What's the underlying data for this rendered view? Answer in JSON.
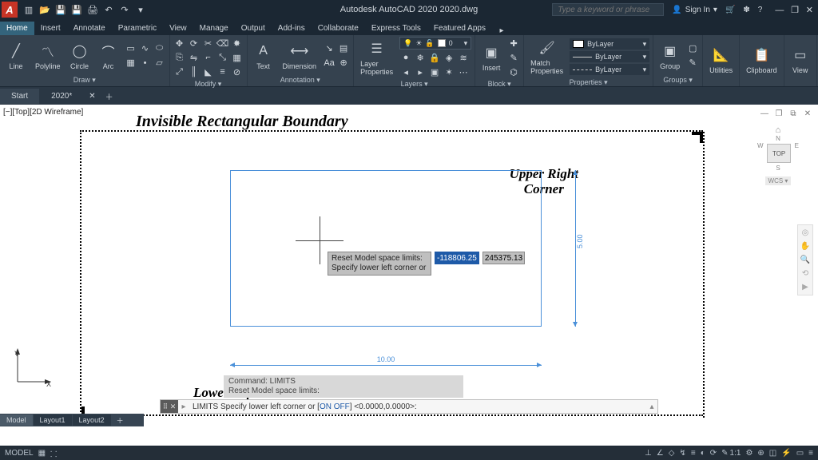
{
  "app_logo_letter": "A",
  "title": "Autodesk AutoCAD 2020   2020.dwg",
  "search_placeholder": "Type a keyword or phrase",
  "signin": "Sign In",
  "ribbon_tabs": [
    "Home",
    "Insert",
    "Annotate",
    "Parametric",
    "View",
    "Manage",
    "Output",
    "Add-ins",
    "Collaborate",
    "Express Tools",
    "Featured Apps"
  ],
  "panels": {
    "draw": {
      "label": "Draw ▾",
      "line": "Line",
      "polyline": "Polyline",
      "circle": "Circle",
      "arc": "Arc"
    },
    "modify": {
      "label": "Modify ▾"
    },
    "annotation": {
      "label": "Annotation ▾",
      "text": "Text",
      "dimension": "Dimension"
    },
    "layers": {
      "label": "Layers ▾",
      "layerprops": "Layer\nProperties",
      "current": "0"
    },
    "block": {
      "label": "Block ▾",
      "insert": "Insert"
    },
    "properties": {
      "label": "Properties ▾",
      "match": "Match\nProperties",
      "bylayer": "ByLayer"
    },
    "groups": {
      "label": "Groups ▾",
      "group": "Group"
    },
    "utilities": {
      "label": "Utilities"
    },
    "clipboard": {
      "label": "Clipboard"
    },
    "view": {
      "label": "View"
    }
  },
  "file_tabs": {
    "start": "Start",
    "doc": "2020*"
  },
  "view_label": "[−][Top][2D Wireframe]",
  "annotations": {
    "title": "Invisible Rectangular Boundary",
    "ur": "Upper Right\nCorner",
    "ll": "Lower Left\nCorner"
  },
  "dims": {
    "width": "10.00",
    "height": "5.00"
  },
  "dynamic_input": {
    "prompt_line1": "Reset Model space limits:",
    "prompt_line2": "Specify lower left corner or",
    "field1": "-118806.25",
    "field2": "245375.13"
  },
  "viewcube": {
    "n": "N",
    "s": "S",
    "e": "E",
    "w": "W",
    "face": "TOP",
    "wcs": "WCS ▾"
  },
  "ucs": {
    "x": "X",
    "y": "Y"
  },
  "command_history": {
    "l1": "Command: LIMITS",
    "l2": "Reset Model space limits:"
  },
  "cmdline": {
    "prefix": "LIMITS ",
    "body": "Specify lower left corner or [",
    "on": "ON",
    "off": "OFF",
    "tail": "] <0.0000,0.0000>:"
  },
  "model_tabs": [
    "Model",
    "Layout1",
    "Layout2"
  ],
  "statusbar": {
    "model": "MODEL",
    "scale": "1:1"
  }
}
